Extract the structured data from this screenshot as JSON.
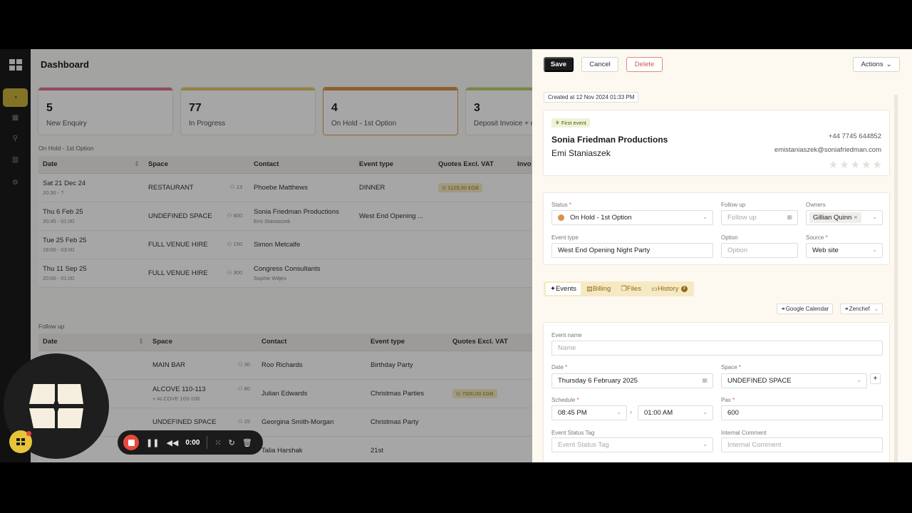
{
  "dashboard": {
    "title": "Dashboard",
    "stats": [
      {
        "num": "5",
        "label": "New Enquiry",
        "color": "#e46f95"
      },
      {
        "num": "77",
        "label": "In Progress",
        "color": "#e4c86a"
      },
      {
        "num": "4",
        "label": "On Hold - 1st Option",
        "color": "#d8924a"
      },
      {
        "num": "3",
        "label": "Deposit Invoice + c",
        "color": "#b6d36a"
      }
    ],
    "table1": {
      "label": "On Hold - 1st Option",
      "headers": [
        "Date",
        "Space",
        "Contact",
        "Event type",
        "Quotes Excl. VAT",
        "Invo"
      ],
      "rows": [
        {
          "date": "Sat 21 Dec 24",
          "time": "20:30 - ?",
          "space": "RESTAURANT",
          "pax": "13",
          "contact": "Phoebe Matthews",
          "contact_sub": "",
          "event": "DINNER",
          "quote": "1125,00 £GB"
        },
        {
          "date": "Thu 6 Feb 25",
          "time": "20:45 - 01:00",
          "space": "UNDEFINED SPACE",
          "pax": "600",
          "contact": "Sonia Friedman Productions",
          "contact_sub": "Emi Staniaszek",
          "event": "West End Opening ...",
          "quote": ""
        },
        {
          "date": "Tue 25 Feb 25",
          "time": "18:00 - 03:00",
          "space": "FULL VENUE HIRE",
          "pax": "150",
          "contact": "Simon Metcalfe",
          "contact_sub": "",
          "event": "",
          "quote": ""
        },
        {
          "date": "Thu 11 Sep 25",
          "time": "20:00 - 01:00",
          "space": "FULL VENUE HIRE",
          "pax": "300",
          "contact": "Congress Consultants",
          "contact_sub": "Sophie Witjes",
          "event": "",
          "quote": ""
        }
      ]
    },
    "table2": {
      "label": "Follow up",
      "headers": [
        "Date",
        "Space",
        "Contact",
        "Event type",
        "Quotes Excl. VAT"
      ],
      "rows": [
        {
          "space": "MAIN BAR",
          "space_sub": "",
          "pax": "30",
          "contact": "Roo Richards",
          "event": "Birthday Party",
          "quote": ""
        },
        {
          "space": "ALCOVE 110-113",
          "space_sub": "+ ALCOVE 103-108",
          "pax": "80",
          "contact": "Julian Edwards",
          "event": "Christmas Parties",
          "quote": "7000,00 £GB"
        },
        {
          "space": "UNDEFINED SPACE",
          "space_sub": "",
          "pax": "25",
          "contact": "Georgina Smith-Morgan",
          "event": "Christmas Party",
          "quote": ""
        },
        {
          "space": "",
          "space_sub": "",
          "pax": "",
          "contact": "Talia Harshak",
          "event": "21st",
          "quote": ""
        }
      ]
    }
  },
  "recorder": {
    "time": "0:00"
  },
  "panel": {
    "save": "Save",
    "cancel": "Cancel",
    "delete": "Delete",
    "actions": "Actions",
    "created": "Created at 12 Nov 2024 01:33 PM",
    "contact": {
      "tag": "First event",
      "company": "Sonia Friedman Productions",
      "person": "Emi Staniaszek",
      "phone": "+44 7745 644852",
      "email": "emistaniaszek@soniafriedman.com",
      "stars": "★★★★★"
    },
    "status_label": "Status",
    "status_value": "On Hold - 1st Option",
    "followup_label": "Follow up",
    "followup_ph": "Follow up",
    "owners_label": "Owners",
    "owner_chip": "Gillian Quinn",
    "eventtype_label": "Event type",
    "eventtype_value": "West End Opening Night Party",
    "option_label": "Option",
    "option_ph": "Option",
    "source_label": "Source",
    "source_value": "Web site",
    "tabs": {
      "events": "Events",
      "billing": "Billing",
      "files": "Files",
      "history": "History",
      "history_count": "3"
    },
    "google_calendar": "Google Calendar",
    "zenchef": "Zenchef",
    "eventname_label": "Event name",
    "eventname_ph": "Name",
    "date_label": "Date",
    "date_value": "Thursday 6 February 2025",
    "space_label": "Space",
    "space_value": "UNDEFINED SPACE",
    "schedule_label": "Schedule",
    "schedule_from": "08:45 PM",
    "schedule_to": "01:00 AM",
    "pax_label": "Pax",
    "pax_value": "600",
    "eststatus_label": "Event Status Tag",
    "eststatus_ph": "Event Status Tag",
    "internal_label": "Internal Comment",
    "internal_ph": "Internal Comment"
  }
}
